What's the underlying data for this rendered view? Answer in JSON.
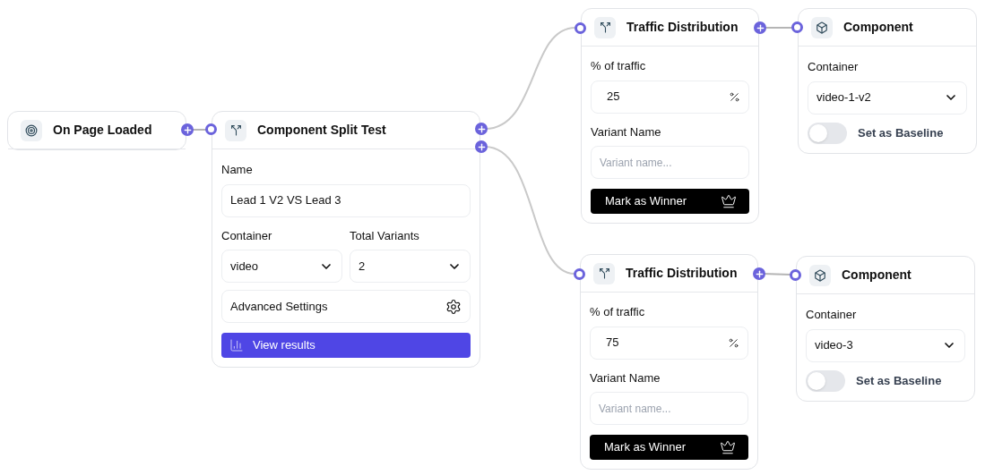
{
  "trigger": {
    "title": "On Page Loaded"
  },
  "split_test": {
    "title": "Component Split Test",
    "name_label": "Name",
    "name_value": "Lead 1 V2 VS Lead 3",
    "container_label": "Container",
    "container_value": "video",
    "variants_label": "Total Variants",
    "variants_value": "2",
    "advanced_label": "Advanced Settings",
    "view_results": "View results"
  },
  "variants": [
    {
      "traffic": {
        "title": "Traffic Distribution",
        "traffic_label": "% of traffic",
        "traffic_value": "25",
        "variant_label": "Variant Name",
        "variant_placeholder": "Variant name...",
        "winner_button": "Mark as Winner"
      },
      "component": {
        "title": "Component",
        "container_label": "Container",
        "container_value": "video-1-v2",
        "baseline_label": "Set as Baseline",
        "baseline_on": false
      }
    },
    {
      "traffic": {
        "title": "Traffic Distribution",
        "traffic_label": "% of traffic",
        "traffic_value": "75",
        "variant_label": "Variant Name",
        "variant_placeholder": "Variant name...",
        "winner_button": "Mark as Winner"
      },
      "component": {
        "title": "Component",
        "container_label": "Container",
        "container_value": "video-3",
        "baseline_label": "Set as Baseline",
        "baseline_on": false
      }
    }
  ]
}
